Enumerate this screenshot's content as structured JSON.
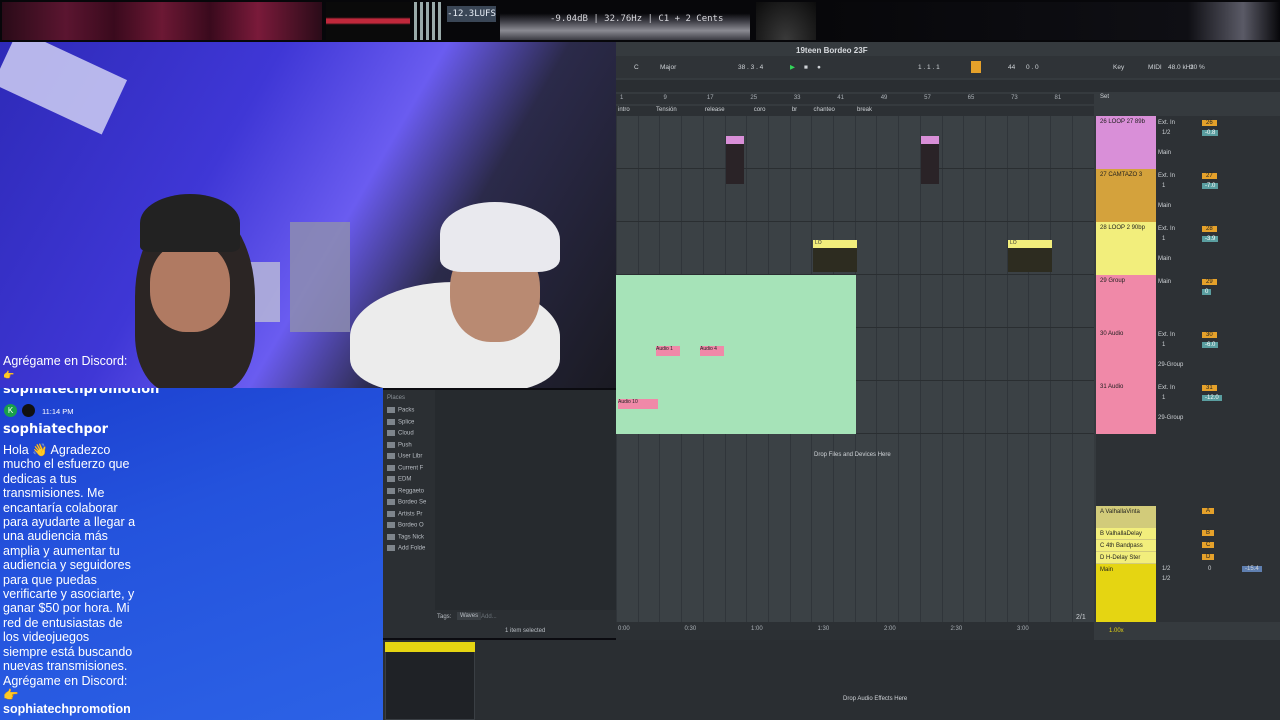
{
  "meters": {
    "lufs": "-12.3LUFS",
    "analyzer": "-9.04dB | 32.76Hz | C1 + 2 Cents"
  },
  "chat": {
    "top_line": "Agrégame en Discord:",
    "top_emoji": "👉",
    "top_user": "sophiatechpromotion",
    "timestamp": "11:14 PM",
    "username": "sophiatechpor",
    "message_lines": [
      "Hola 👋 Agradezco",
      "mucho el esfuerzo que",
      "dedicas a tus",
      "transmisiones. Me",
      "encantaría colaborar",
      "para ayudarte a llegar a",
      "una audiencia más",
      "amplia y aumentar tu",
      "audiencia y seguidores",
      "para que puedas",
      "verificarte y asociarte, y",
      "ganar $50 por hora. Mi",
      "red de entusiastas de",
      "los videojuegos",
      "siempre está buscando",
      "nuevas transmisiones.",
      "Agrégame en Discord:",
      "👉",
      "sophiatechpromotion"
    ]
  },
  "browser": {
    "header": "Places",
    "items": [
      "Packs",
      "Splice",
      "Cloud",
      "Push",
      "User Libr",
      "Current F",
      "EDM",
      "Reggaeto",
      "Bordeo Se",
      "Artists Pr",
      "Bordeo O",
      "Tags Nick",
      "Add Folde"
    ],
    "tags_label": "Tags:",
    "tag_value": "Waves",
    "tag_add": "Add...",
    "status": "1 item selected"
  },
  "ableton": {
    "title": "19teen Bordeo 23F",
    "key_root": "C",
    "scale": "Major",
    "position": "38 . 3 . 4",
    "loop_start": "1 . 1 . 1",
    "tempo_num": "44",
    "loop_end": "0 . 0",
    "key_label": "Key",
    "midi_label": "MIDI",
    "sample_rate": "48.0 kHz",
    "cpu": "30 %",
    "set_label": "Set",
    "bars": [
      "1",
      "9",
      "17",
      "25",
      "33",
      "41",
      "49",
      "57",
      "65",
      "73",
      "81"
    ],
    "locators": [
      "intro",
      "Tensión",
      "release",
      "coro",
      "br",
      "chanteo",
      "break"
    ],
    "drop_hint": "Drop Files and Devices Here",
    "times": [
      "0:00",
      "0:30",
      "1:00",
      "1:30",
      "2:00",
      "2:30",
      "3:00"
    ],
    "page": "2/1",
    "zoom": "1.00x",
    "drop_effects": "Drop Audio Effects Here",
    "clip_audio1": "Audio 1",
    "clip_audio2": "Audio 4",
    "clip_audio10": "Audio 10",
    "clip_lo": "LO",
    "tracks": [
      {
        "name": "26 LOOP 27 89b",
        "input": "Ext. In",
        "ch": "1/2",
        "num": "26",
        "vol": "-0.8",
        "out": "Main",
        "color": "#d98fd8"
      },
      {
        "name": "27 CAMTAZO 3",
        "input": "Ext. In",
        "ch": "1",
        "num": "27",
        "vol": "-7.0",
        "out": "Main",
        "color": "#d4a23c"
      },
      {
        "name": "28 LOOP 2 90bp",
        "input": "Ext. In",
        "ch": "1",
        "num": "28",
        "vol": "-3.9",
        "out": "Main",
        "color": "#f2ee7c"
      },
      {
        "name": "29 Group",
        "input": "Main",
        "ch": "",
        "num": "29",
        "vol": "0",
        "out": "",
        "color": "#f089a8"
      },
      {
        "name": "30 Audio",
        "input": "Ext. In",
        "ch": "1",
        "num": "30",
        "vol": "-6.0",
        "out": "29-Group",
        "color": "#f089a8"
      },
      {
        "name": "31 Audio",
        "input": "Ext. In",
        "ch": "1",
        "num": "31",
        "vol": "-12.0",
        "out": "29-Group",
        "color": "#f089a8"
      }
    ],
    "returns": [
      {
        "name": "A ValhallaVinta",
        "letter": "A",
        "color": "#d2cb7a"
      },
      {
        "name": "B ValhallaDelay",
        "letter": "B",
        "color": "#f2ee7c"
      },
      {
        "name": "C 4th Bandpass",
        "letter": "C",
        "color": "#f2ee7c"
      },
      {
        "name": "D H-Delay Ster",
        "letter": "D",
        "color": "#f2ee7c"
      }
    ],
    "main": {
      "name": "Main",
      "ch1": "1/2",
      "ch2": "1/2",
      "vol": "0",
      "peak": "-15.4",
      "color": "#e5d512"
    }
  },
  "colors": {
    "audio_clip": "#a6e3b8",
    "locator_bar": "#2c3034",
    "accent": "#e5d512"
  }
}
